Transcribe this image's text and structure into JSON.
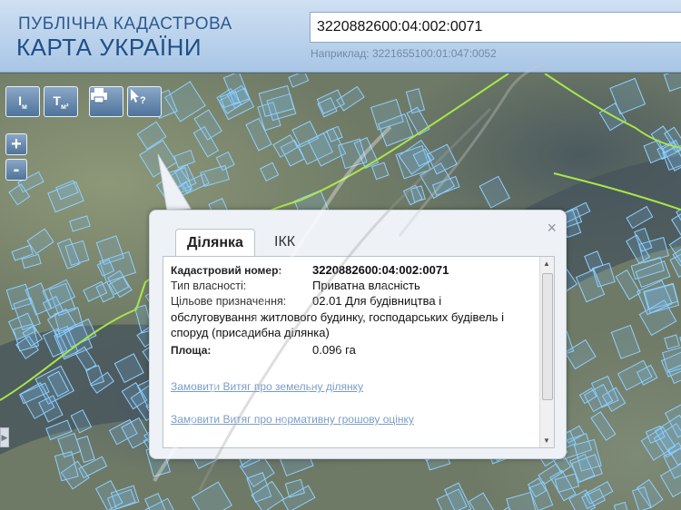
{
  "header": {
    "title_line1": "ПУБЛІЧНА КАДАСТРОВА",
    "title_line2": "КАРТА УКРАЇНИ",
    "search_value": "3220882600:04:002:0071",
    "search_hint": "Наприклад: 3221655100:01:047:0052"
  },
  "toolbar": {
    "measure_length_label": "I",
    "measure_length_unit": "м",
    "measure_area_label": "T",
    "measure_area_unit": "м²",
    "print_icon": "printer-icon",
    "identify_icon": "cursor-question-icon",
    "zoom_in_label": "+",
    "zoom_out_label": "-"
  },
  "popup": {
    "tabs": [
      "Ділянка",
      "ІКК"
    ],
    "close_label": "×",
    "fields": {
      "cadastral_label": "Кадастровий номер:",
      "cadastral_value": "3220882600:04:002:0071",
      "ownership_label": "Тип власності:",
      "ownership_value": "Приватна власність",
      "purpose_label": "Цільове призначення:",
      "purpose_value_line1": "02.01 Для будівництва і",
      "purpose_value_rest": "обслуговування житлового будинку, господарських будівель і споруд (присадибна ділянка)",
      "area_label": "Площа:",
      "area_value": "0.096 га"
    },
    "links": [
      "Замовити Витяг про земельну ділянку",
      "Замовити Витяг про нормативну грошову оцінку"
    ]
  },
  "colors": {
    "parcel_outline": "#8fd0ff",
    "boundary_line": "#a8e64a",
    "header_text": "#1f4f86",
    "link": "#7a9cc6"
  }
}
